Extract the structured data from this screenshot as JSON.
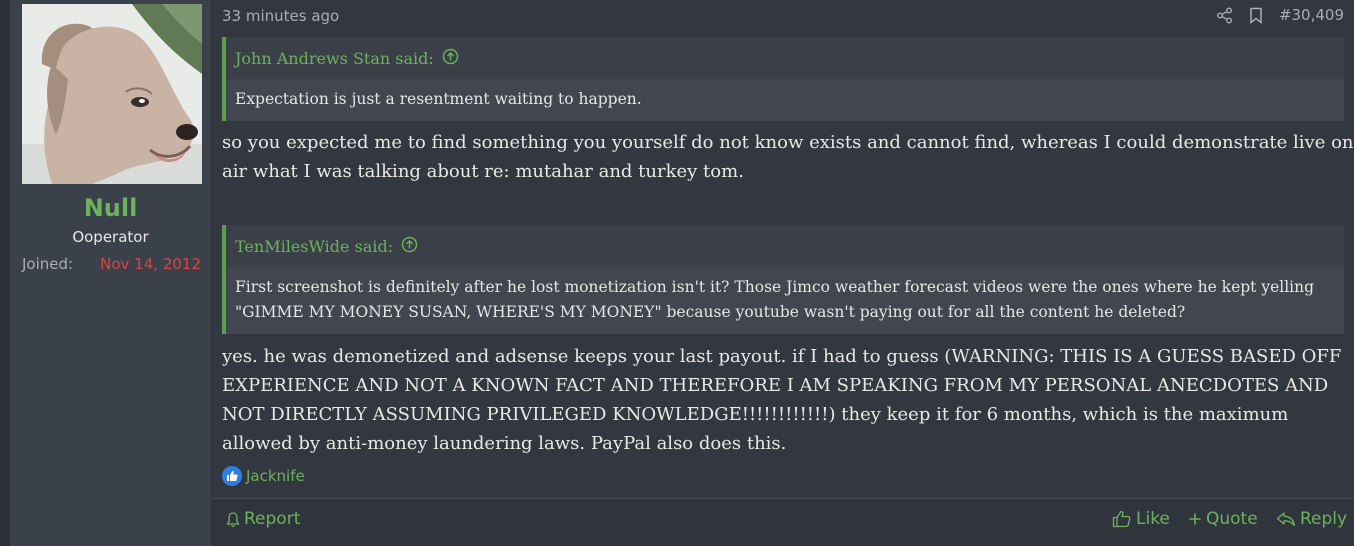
{
  "user": {
    "name": "Null",
    "title": "Ooperator",
    "joined_label": "Joined:",
    "joined_date": "Nov 14, 2012",
    "avatar_icon": "dog-avatar"
  },
  "post": {
    "time": "33 minutes ago",
    "number": "#30,409",
    "share_icon": "share-icon",
    "bookmark_icon": "bookmark-icon"
  },
  "quotes": [
    {
      "author": "John Andrews Stan said:",
      "body": "Expectation is just a resentment waiting to happen."
    },
    {
      "author": "TenMilesWide said:",
      "body": "First screenshot is definitely after he lost monetization isn't it? Those Jimco weather forecast videos were the ones where he kept yelling \"GIMME MY MONEY SUSAN, WHERE'S MY MONEY\" because youtube wasn't paying out for all the content he deleted?"
    }
  ],
  "messages": [
    "so you expected me to find something you yourself do not know exists and cannot find, whereas I could demonstrate live on air what I was talking about re: mutahar and turkey tom.",
    "yes. he was demonetized and adsense keeps your last payout. if I had to guess (WARNING: THIS IS A GUESS BASED OFF EXPERIENCE AND NOT A KNOWN FACT AND THEREFORE I AM SPEAKING FROM MY PERSONAL ANECDOTES AND NOT DIRECTLY ASSUMING PRIVILEGED KNOWLEDGE!!!!!!!!!!!!) they keep it for 6 months, which is the maximum allowed by anti-money laundering laws. PayPal also does this."
  ],
  "reactions": {
    "user": "Jacknife"
  },
  "actions": {
    "report": "Report",
    "like": "Like",
    "quote": "Quote",
    "reply": "Reply"
  },
  "colors": {
    "accent": "#6bb35a",
    "joined_date": "#d64545",
    "like_badge": "#2f7fe0"
  }
}
